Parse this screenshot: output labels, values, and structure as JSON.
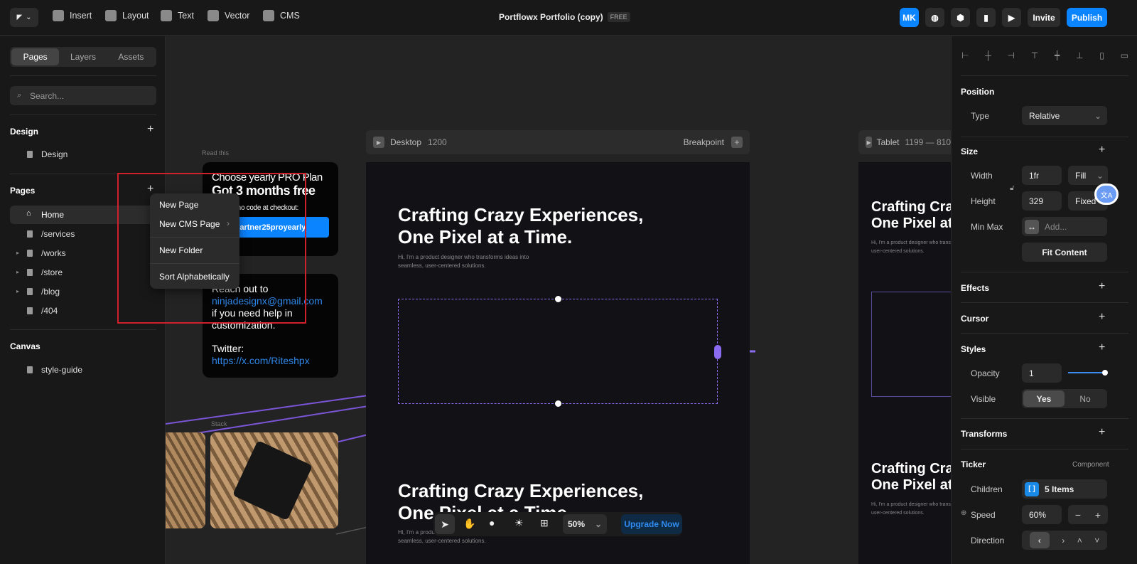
{
  "topbar": {
    "insert": "Insert",
    "layout": "Layout",
    "text": "Text",
    "vector": "Vector",
    "cms": "CMS",
    "title": "Portflowx Portfolio (copy)",
    "plan_badge": "FREE",
    "avatar": "MK",
    "invite": "Invite",
    "publish": "Publish"
  },
  "left": {
    "tabs": [
      "Pages",
      "Layers",
      "Assets"
    ],
    "search_placeholder": "Search...",
    "design_heading": "Design",
    "design_item": "Design",
    "pages_heading": "Pages",
    "pages": [
      "Home",
      "/services",
      "/works",
      "/store",
      "/blog",
      "/404"
    ],
    "canvas_heading": "Canvas",
    "canvas_item": "style-guide"
  },
  "context_menu": {
    "items": [
      "New Page",
      "New CMS Page",
      "New Folder",
      "Sort Alphabetically"
    ]
  },
  "canvas": {
    "read_this": "Read this",
    "promo_line1": "Choose yearly PRO Plan",
    "promo_line2": "Got 3 months free",
    "promo_line3": "Use promo code at checkout:",
    "promo_code": "partner25proyearly",
    "help_line1": "Reach out to",
    "help_email": "ninjadesignx@gmail.com",
    "help_line2": "if you need help in customization.",
    "twitter_label": "Twitter:",
    "twitter_url": "https://x.com/Riteshpx",
    "stack_label": "Stack",
    "desktop": {
      "label": "Desktop",
      "width": "1200",
      "breakpoint": "Breakpoint"
    },
    "tablet": {
      "label": "Tablet",
      "range": "1199 — 810"
    },
    "hero_title": "Crafting Crazy Experiences, One Pixel at a Time.",
    "hero_sub": "Hi, I'm a product designer who transforms ideas into seamless, user-centered solutions.",
    "tablet_title": "Crafting Crazy Experiences, One Pixel at a Time."
  },
  "toolbar": {
    "zoom": "50%",
    "upgrade": "Upgrade Now"
  },
  "right": {
    "position": "Position",
    "type_label": "Type",
    "type_value": "Relative",
    "size": "Size",
    "width_label": "Width",
    "width_value": "1fr",
    "width_mode": "Fill",
    "height_label": "Height",
    "height_value": "329",
    "height_mode": "Fixed",
    "minmax_label": "Min Max",
    "minmax_placeholder": "Add...",
    "fit_content": "Fit Content",
    "effects": "Effects",
    "cursor": "Cursor",
    "styles": "Styles",
    "opacity_label": "Opacity",
    "opacity_value": "1",
    "visible_label": "Visible",
    "visible_yes": "Yes",
    "visible_no": "No",
    "transforms": "Transforms",
    "ticker": "Ticker",
    "component": "Component",
    "children_label": "Children",
    "children_value": "5 Items",
    "speed_label": "Speed",
    "speed_value": "60%",
    "direction_label": "Direction"
  },
  "colors": {
    "accent": "#0a84ff",
    "selection": "#8b6cf0",
    "highlight_box": "#d0202a"
  }
}
